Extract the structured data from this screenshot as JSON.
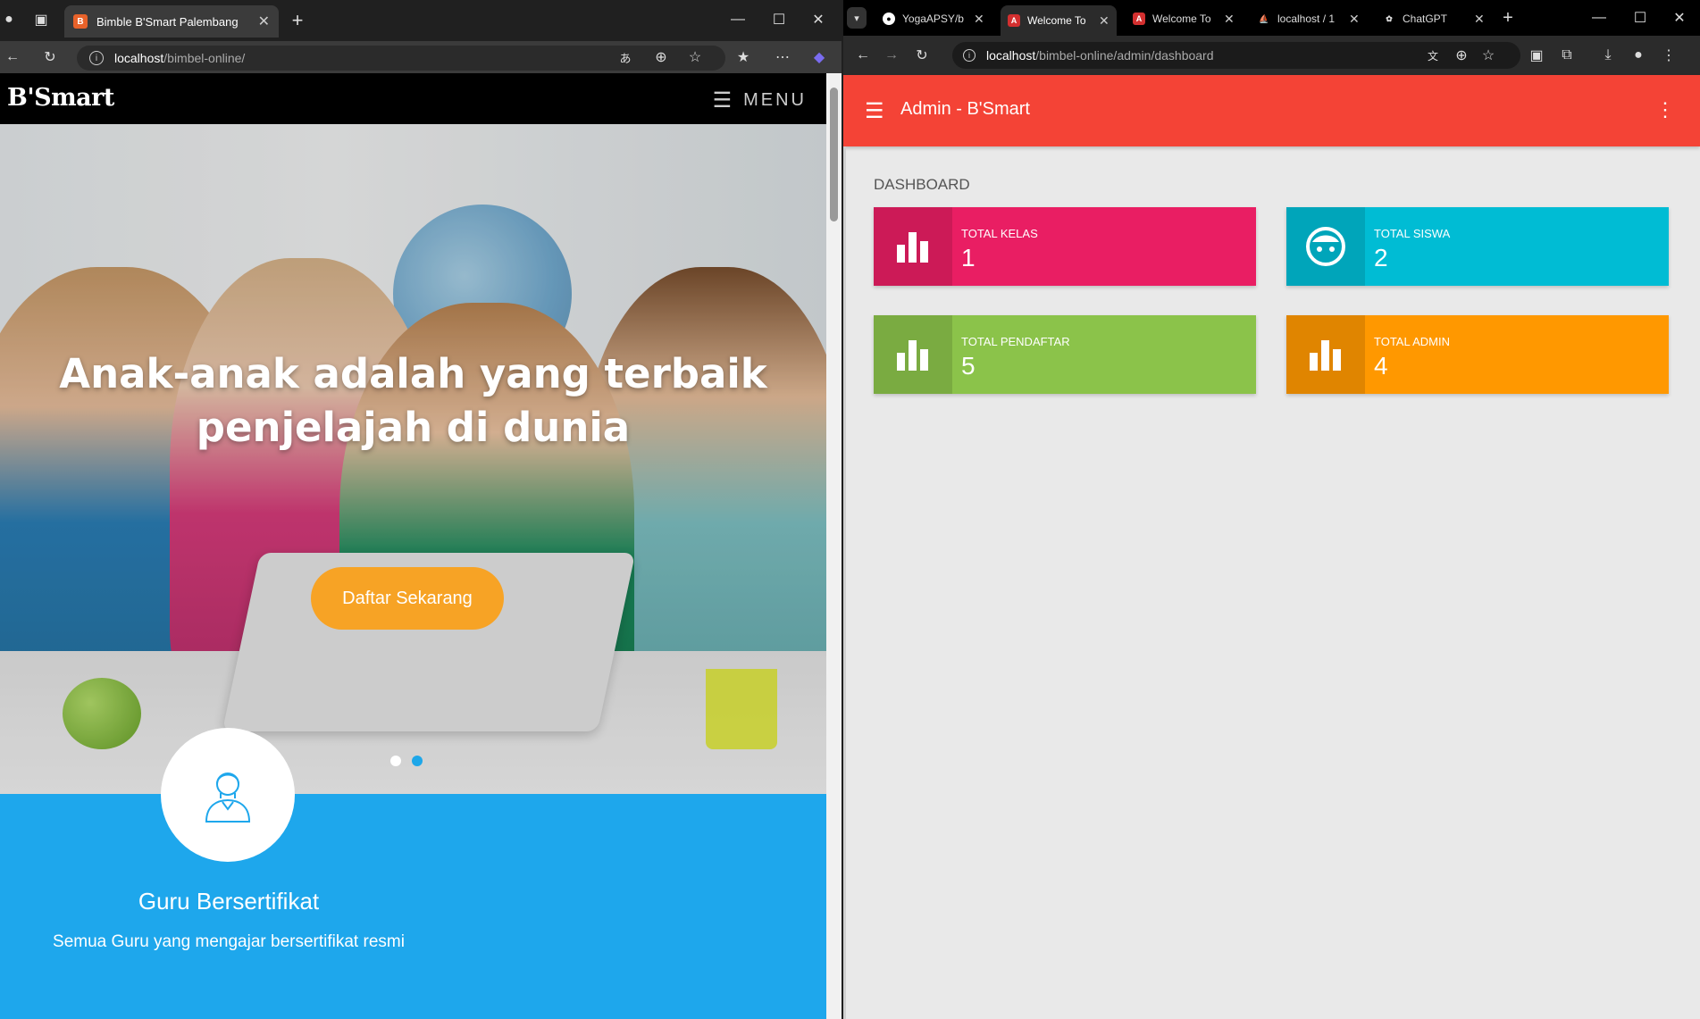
{
  "left_window": {
    "tab_title": "Bimble B'Smart Palembang",
    "url_host": "localhost",
    "url_path": "/bimbel-online/",
    "brand": "B'Smart",
    "menu_label": "MENU",
    "hero_title": "Anak-anak adalah yang terbaik penjelajah di dunia",
    "cta_label": "Daftar Sekarang",
    "feature": {
      "title": "Guru Bersertifikat",
      "desc": "Semua Guru yang mengajar bersertifikat resmi"
    }
  },
  "right_window": {
    "tabs": [
      {
        "label": "YogaAPSY/b",
        "icon": "github-icon"
      },
      {
        "label": "Welcome To",
        "icon": "app-icon",
        "active": true
      },
      {
        "label": "Welcome To",
        "icon": "app-icon"
      },
      {
        "label": "localhost / 1",
        "icon": "phpmyadmin-icon"
      },
      {
        "label": "ChatGPT",
        "icon": "chatgpt-icon"
      }
    ],
    "url_host": "localhost",
    "url_path": "/bimbel-online/admin/dashboard",
    "app_title": "Admin - B'Smart",
    "section_title": "DASHBOARD",
    "cards": [
      {
        "label": "TOTAL KELAS",
        "value": "1",
        "color": "#e91e63",
        "icon": "bar-chart-icon"
      },
      {
        "label": "TOTAL SISWA",
        "value": "2",
        "color": "#00bcd4",
        "icon": "face-icon"
      },
      {
        "label": "TOTAL PENDAFTAR",
        "value": "5",
        "color": "#8bc34a",
        "icon": "bar-chart-icon"
      },
      {
        "label": "TOTAL ADMIN",
        "value": "4",
        "color": "#ff9800",
        "icon": "bar-chart-icon"
      }
    ]
  }
}
